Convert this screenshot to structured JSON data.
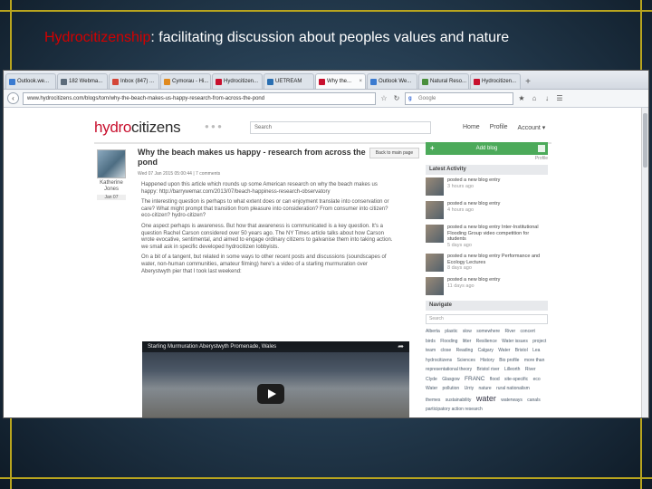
{
  "slide": {
    "title_accent": "Hydrocitizenship",
    "title_rest": ": facilitating discussion about peoples values and nature",
    "frame_color": "#b9a51e"
  },
  "browser": {
    "tabs": [
      {
        "label": "Outlook.we...",
        "color": "#3b7bd0",
        "active": false
      },
      {
        "label": "182 Webma...",
        "color": "#5c6b7a",
        "active": false
      },
      {
        "label": "Inbox (847) ...",
        "color": "#d44638",
        "active": false
      },
      {
        "label": "Cymorau - Hi...",
        "color": "#e08a1e",
        "active": false
      },
      {
        "label": "Hydrocitizen...",
        "color": "#c8102e",
        "active": false
      },
      {
        "label": "UETREAM",
        "color": "#2a6fb1",
        "active": false
      },
      {
        "label": "Why the...",
        "color": "#c8102e",
        "active": true
      },
      {
        "label": "Outlook We...",
        "color": "#3b7bd0",
        "active": false
      },
      {
        "label": "Natural Reso...",
        "color": "#4a8f3c",
        "active": false
      },
      {
        "label": "Hydrocitizen...",
        "color": "#c8102e",
        "active": false
      }
    ],
    "url": "www.hydrocitizens.com/blogs/tom/why-the-beach-makes-us-happy-research-from-across-the-pond",
    "search_placeholder": "Google"
  },
  "site": {
    "logo_hydro": "hydro",
    "logo_citizens": "citizens",
    "search_placeholder": "Search",
    "nav": [
      "Home",
      "Profile",
      "Account ▾"
    ]
  },
  "post": {
    "title": "Why the beach makes us happy - research from across the pond",
    "back_label": "Back to main page",
    "meta": "Wed 07 Jan 2015 05:00:44 | 7 comments",
    "author_name": "Katherine Jones",
    "author_date": "Jan 07",
    "paragraphs": [
      "Happened upon this article which rounds up some American research on why the beach makes us happy: http://barrywemar.com/2013/07/beach-happiness-research-observatory",
      "The interesting question is perhaps to what extent does or can enjoyment translate into conservation or care? What might prompt that transition from pleasure into consideration? From consumer into citizen? eco-citizen? hydro-citizen?",
      "One aspect perhaps is awareness. But how that awareness is communicated is a key question. It's a question Rachel Carson considered over 50 years ago. The NY Times article talks about how Carson wrote evocative, sentimental, and aimed to engage ordinary citizens to galvanise them into taking action. we small ask in specific developed hydrocitizen lobbyists.",
      "On a bit of a tangent, but related in some ways to other recent posts and discussions (soundscapes of water, non-human communities, amateur filming) here's a video of a starling murmuration over Aberystwyth pier that I took last weekend:"
    ],
    "video_title": "Starling Murmuration Aberystwyth Promenade, Wales"
  },
  "sidebar": {
    "add_blog": "Add blog",
    "profile_link": "Profile",
    "latest_activity_title": "Latest Activity",
    "activity": [
      {
        "text": "posted a new blog entry",
        "time": "3 hours ago"
      },
      {
        "text": "posted a new blog entry",
        "time": "4 hours ago"
      },
      {
        "text": "posted a new blog entry Inter-Institutional Flooding Group video competition for students",
        "time": "5 days ago"
      },
      {
        "text": "posted a new blog entry Performance and Ecology Lectures",
        "time": "8 days ago"
      },
      {
        "text": "posted a new blog entry",
        "time": "11 days ago"
      }
    ],
    "navigate_title": "Navigate",
    "search_placeholder": "Search",
    "tags": [
      {
        "t": "Alberta",
        "s": "n"
      },
      {
        "t": "plastic",
        "s": "n"
      },
      {
        "t": "slow",
        "s": "n"
      },
      {
        "t": "somewhere",
        "s": "n"
      },
      {
        "t": "River",
        "s": "n"
      },
      {
        "t": "concert",
        "s": "n"
      },
      {
        "t": "birds",
        "s": "n"
      },
      {
        "t": "Flooding",
        "s": "n"
      },
      {
        "t": "litter",
        "s": "n"
      },
      {
        "t": "Resilience",
        "s": "n"
      },
      {
        "t": "Water issues",
        "s": "n"
      },
      {
        "t": "project team",
        "s": "n"
      },
      {
        "t": "close",
        "s": "n"
      },
      {
        "t": "Reading",
        "s": "n"
      },
      {
        "t": "Calgary",
        "s": "n"
      },
      {
        "t": "Water",
        "s": "n"
      },
      {
        "t": "Bristol",
        "s": "n"
      },
      {
        "t": "Lea",
        "s": "n"
      },
      {
        "t": "hydrocitizens",
        "s": "n"
      },
      {
        "t": "Sciences",
        "s": "n"
      },
      {
        "t": "History",
        "s": "n"
      },
      {
        "t": "Bio profile",
        "s": "n"
      },
      {
        "t": "more than representational theory",
        "s": "n"
      },
      {
        "t": "Bristol river",
        "s": "n"
      },
      {
        "t": "Lilleorth",
        "s": "n"
      },
      {
        "t": "River Clyde",
        "s": "n"
      },
      {
        "t": "Glasgow",
        "s": "n"
      },
      {
        "t": "FRANC",
        "s": "m"
      },
      {
        "t": "flood",
        "s": "n"
      },
      {
        "t": "site-specific",
        "s": "n"
      },
      {
        "t": "eco",
        "s": "n"
      },
      {
        "t": "Water",
        "s": "n"
      },
      {
        "t": "pollution",
        "s": "n"
      },
      {
        "t": "Urriy",
        "s": "n"
      },
      {
        "t": "nature",
        "s": "n"
      },
      {
        "t": "rural nationalism",
        "s": "n"
      },
      {
        "t": "themes",
        "s": "n"
      },
      {
        "t": "sustainability",
        "s": "n"
      },
      {
        "t": "water",
        "s": "b"
      },
      {
        "t": "waterways",
        "s": "n"
      },
      {
        "t": "canals",
        "s": "n"
      },
      {
        "t": "participatory action research",
        "s": "n"
      }
    ]
  }
}
